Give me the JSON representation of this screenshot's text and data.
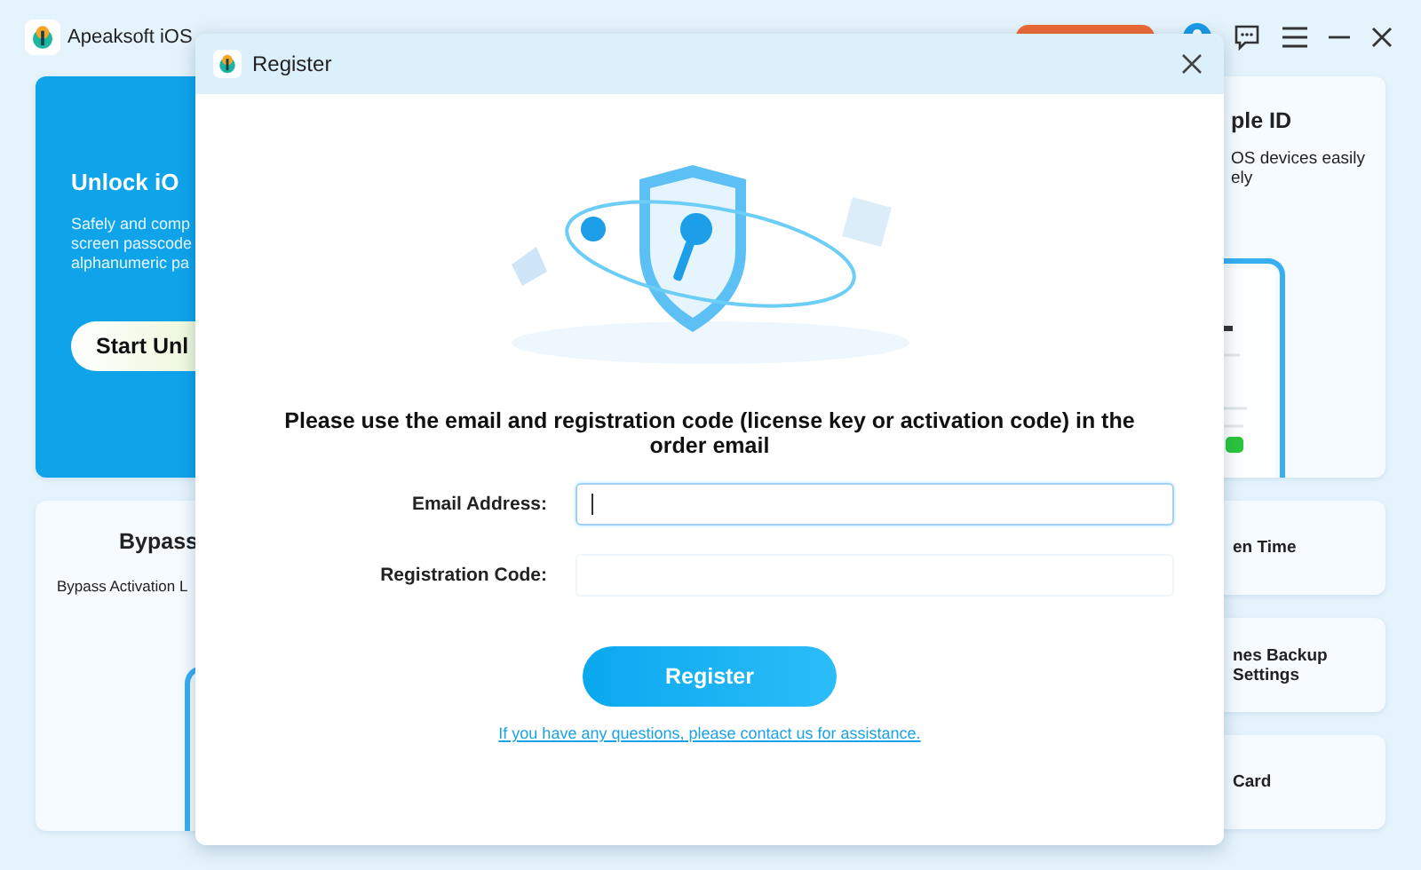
{
  "app": {
    "title": "Apeaksoft iOS"
  },
  "left_cards": [
    {
      "kind": "hero",
      "title": "Unlock iO",
      "description_lines": [
        "Safely and comp",
        "screen passcode",
        "alphanumeric pa"
      ],
      "button": "Start Unl"
    },
    {
      "kind": "phone",
      "title": "Bypass",
      "description_lines": [
        "Bypass Activation L"
      ]
    }
  ],
  "right_cards": [
    {
      "kind": "phone",
      "title": "ple ID",
      "description_lines": [
        "OS devices easily",
        "ely"
      ]
    },
    {
      "kind": "plain",
      "title_lines": [
        "en Time"
      ]
    },
    {
      "kind": "plain",
      "title_lines": [
        "nes Backup",
        "Settings"
      ]
    },
    {
      "kind": "plain",
      "title_lines": [
        "Card"
      ]
    }
  ],
  "dialog": {
    "title": "Register",
    "message": "Please use the email and registration code (license key or activation code) in the order email",
    "fields": [
      {
        "label": "Email Address:",
        "focused": true
      },
      {
        "label": "Registration Code:",
        "focused": false
      }
    ],
    "button": "Register",
    "link": "If you have any questions, please contact us for assistance."
  }
}
